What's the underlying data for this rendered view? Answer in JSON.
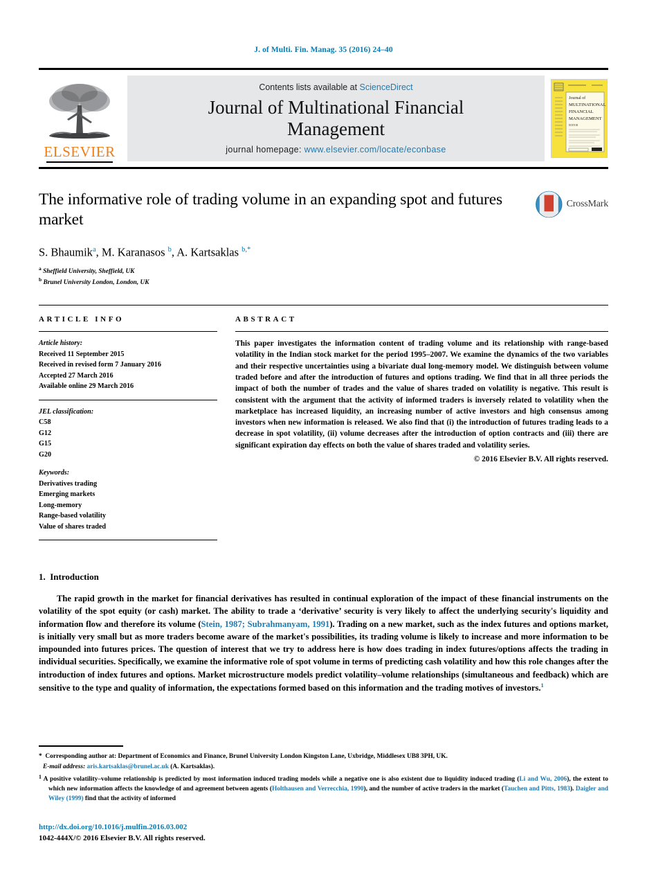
{
  "running_head": "J. of Multi. Fin. Manag. 35 (2016) 24–40",
  "masthead": {
    "publisher_name": "ELSEVIER",
    "contents_prefix": "Contents lists available at ",
    "contents_link": "ScienceDirect",
    "journal_title_line1": "Journal of Multinational Financial",
    "journal_title_line2": "Management",
    "homepage_prefix": "journal homepage: ",
    "homepage_link": "www.elsevier.com/locate/econbase",
    "cover": {
      "line1": "Journal of",
      "line2": "MULTINATIONAL",
      "line3": "FINANCIAL",
      "line4": "MANAGEMENT",
      "editor_label": "EDITOR"
    }
  },
  "article": {
    "title": "The informative role of trading volume in an expanding spot and futures market",
    "authors_html": "S. Bhaumik<sup>a</sup>, M. Karanasos <sup>b</sup>, A. Kartsaklas <sup>b,*</sup>",
    "affiliations": [
      {
        "marker": "a",
        "text": "Sheffield University, Sheffield, UK"
      },
      {
        "marker": "b",
        "text": "Brunel University London, London, UK"
      }
    ],
    "crossmark_label": "CrossMark"
  },
  "article_info": {
    "heading": "ARTICLE INFO",
    "history_title": "Article history:",
    "history": [
      "Received 11 September 2015",
      "Received in revised form 7 January 2016",
      "Accepted 27 March 2016",
      "Available online 29 March 2016"
    ],
    "jel_title": "JEL classification:",
    "jel_codes": [
      "C58",
      "G12",
      "G15",
      "G20"
    ],
    "keywords_title": "Keywords:",
    "keywords": [
      "Derivatives trading",
      "Emerging markets",
      "Long-memory",
      "Range-based volatility",
      "Value of shares traded"
    ]
  },
  "abstract": {
    "heading": "ABSTRACT",
    "text": "This paper investigates the information content of trading volume and its relationship with range-based volatility in the Indian stock market for the period 1995–2007. We examine the dynamics of the two variables and their respective uncertainties using a bivariate dual long-memory model. We distinguish between volume traded before and after the introduction of futures and options trading. We find that in all three periods the impact of both the number of trades and the value of shares traded on volatility is negative. This result is consistent with the argument that the activity of informed traders is inversely related to volatility when the marketplace has increased liquidity, an increasing number of active investors and high consensus among investors when new information is released. We also find that (i) the introduction of futures trading leads to a decrease in spot volatility, (ii) volume decreases after the introduction of option contracts and (iii) there are significant expiration day effects on both the value of shares traded and volatility series.",
    "copyright": "© 2016 Elsevier B.V. All rights reserved."
  },
  "introduction": {
    "number": "1.",
    "heading": "Introduction",
    "paragraph_html": "The rapid growth in the market for financial derivatives has resulted in continual exploration of the impact of these financial instruments on the volatility of the spot equity (or cash) market. The ability to trade a ‘derivative’ security is very likely to affect the underlying security's liquidity and information flow and therefore its volume (<span class=\"link\">Stein, 1987; Subrahmanyam, 1991</span>). Trading on a new market, such as the index futures and options market, is initially very small but as more traders become aware of the market's possibilities, its trading volume is likely to increase and more information to be impounded into futures prices. The question of interest that we try to address here is how does trading in index futures/options affects the trading in individual securities. Specifically, we examine the informative role of spot volume in terms of predicting cash volatility and how this role changes after the introduction of index futures and options. Market microstructure models predict volatility–volume relationships (simultaneous and feedback) which are sensitive to the type and quality of information, the expectations formed based on this information and the trading motives of investors.<sup>1</sup>"
  },
  "footnotes": {
    "corresponding_html": "<span class=\"marker\">*</span>&nbsp; Corresponding author at: Department of Economics and Finance, Brunel University London Kingston Lane, Uxbridge, Middlesex UB8 3PH, UK.",
    "email_html": "<em>E-mail address:</em> <span class=\"link\">aris.kartsaklas@brunel.ac.uk</span> (A. Kartsaklas).",
    "note1_html": "<span class=\"marker\"><sup>1</sup></span> A positive volatility–volume relationship is predicted by most information induced trading models while a negative one is also existent due to liquidity induced trading (<span class=\"link\">Li and Wu, 2006</span>), the extent to which new information affects the knowledge of and agreement between agents (<span class=\"link\">Holthausen and Verrecchia, 1990</span>), and the number of active traders in the market (<span class=\"link\">Tauchen and Pitts, 1983</span>). <span class=\"link\">Daigler and Wiley (1999)</span> find that the activity of informed"
  },
  "footer": {
    "doi": "http://dx.doi.org/10.1016/j.mulfin.2016.03.002",
    "issn_copyright": "1042-444X/© 2016 Elsevier B.V. All rights reserved."
  },
  "colors": {
    "link": "#1f7ab0",
    "running_head": "#0b7aaf",
    "elsevier_orange": "#ef7d1a",
    "masthead_grey": "#e6e7e8",
    "cover_yellow": "#f7e23d"
  }
}
